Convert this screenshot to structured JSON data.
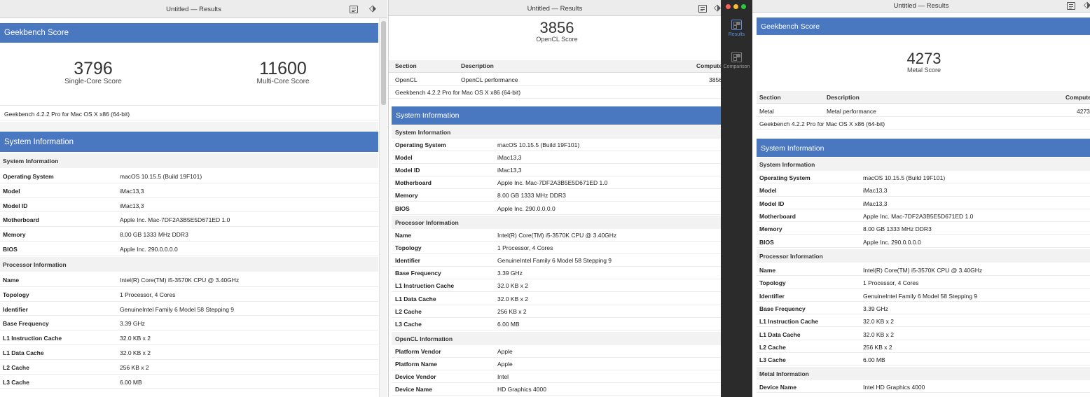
{
  "window_title": "Untitled — Results",
  "geekbench_header": "Geekbench Score",
  "system_info_header": "System Information",
  "version_text": "Geekbench 4.2.2 Pro for Mac OS X x86 (64-bit)",
  "win1": {
    "single_core": {
      "value": "3796",
      "label": "Single-Core Score"
    },
    "multi_core": {
      "value": "11600",
      "label": "Multi-Core Score"
    }
  },
  "win2": {
    "score": {
      "value": "3856",
      "label": "OpenCL Score"
    }
  },
  "win3": {
    "score": {
      "value": "4273",
      "label": "Metal Score"
    }
  },
  "table_headers": {
    "section": "Section",
    "description": "Description",
    "compute": "Compute"
  },
  "opencl_row": {
    "section": "OpenCL",
    "description": "OpenCL performance",
    "compute": "3856"
  },
  "metal_row": {
    "section": "Metal",
    "description": "Metal performance",
    "compute": "4273"
  },
  "sections": {
    "system": "System Information",
    "processor": "Processor Information",
    "opencl": "OpenCL Information",
    "metal": "Metal Information"
  },
  "system_rows": [
    {
      "k": "Operating System",
      "v": "macOS 10.15.5 (Build 19F101)"
    },
    {
      "k": "Model",
      "v": "iMac13,3"
    },
    {
      "k": "Model ID",
      "v": "iMac13,3"
    },
    {
      "k": "Motherboard",
      "v": "Apple Inc. Mac-7DF2A3B5E5D671ED 1.0"
    },
    {
      "k": "Memory",
      "v": "8.00 GB 1333 MHz DDR3"
    },
    {
      "k": "BIOS",
      "v": "Apple Inc. 290.0.0.0.0"
    }
  ],
  "processor_rows": [
    {
      "k": "Name",
      "v": "Intel(R) Core(TM) i5-3570K CPU @ 3.40GHz"
    },
    {
      "k": "Topology",
      "v": "1 Processor, 4 Cores"
    },
    {
      "k": "Identifier",
      "v": "GenuineIntel Family 6 Model 58 Stepping 9"
    },
    {
      "k": "Base Frequency",
      "v": "3.39 GHz"
    },
    {
      "k": "L1 Instruction Cache",
      "v": "32.0 KB x 2"
    },
    {
      "k": "L1 Data Cache",
      "v": "32.0 KB x 2"
    },
    {
      "k": "L2 Cache",
      "v": "256 KB x 2"
    },
    {
      "k": "L3 Cache",
      "v": "6.00 MB"
    }
  ],
  "opencl_rows": [
    {
      "k": "Platform Vendor",
      "v": "Apple"
    },
    {
      "k": "Platform Name",
      "v": "Apple"
    },
    {
      "k": "Device Vendor",
      "v": "Intel"
    },
    {
      "k": "Device Name",
      "v": "HD Graphics 4000"
    }
  ],
  "metal_rows": [
    {
      "k": "Device Name",
      "v": "Intel HD Graphics 4000"
    }
  ],
  "sidebar": {
    "results_label": "Results",
    "comparison_label": "Comparison"
  },
  "colors": {
    "accent": "#4a78c0",
    "sidebar_bg": "#2b2b2b",
    "dot_red": "#ff5f57",
    "dot_yellow": "#febc2e",
    "dot_green": "#28c840"
  }
}
